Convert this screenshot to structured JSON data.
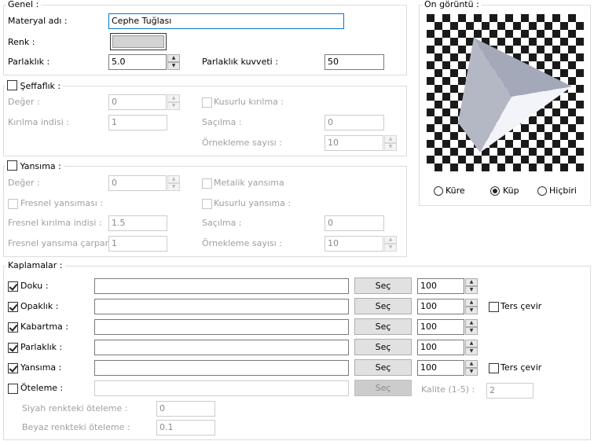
{
  "general": {
    "legend": "Genel :",
    "material_name_label": "Materyal adı :",
    "material_name_value": "Cephe Tuğlası",
    "color_label": "Renk :",
    "color_value": "#d3d3d3",
    "brightness_label": "Parlaklık :",
    "brightness_value": "5.0",
    "brightness_strength_label": "Parlaklık kuvveti :",
    "brightness_strength_value": "50"
  },
  "transparency": {
    "legend": "Şeffaflık :",
    "value_label": "Değer :",
    "value": "0",
    "refraction_index_label": "Kırılma indisi :",
    "refraction_index": "1",
    "imperfect_refraction_label": "Kusurlu kırılma :",
    "scatter_label": "Saçılma :",
    "scatter_value": "0",
    "sample_count_label": "Örnekleme sayısı :",
    "sample_count_value": "10"
  },
  "reflection": {
    "legend": "Yansıma :",
    "value_label": "Değer :",
    "value": "0",
    "metallic_label": "Metalik yansıma",
    "fresnel_label": "Fresnel yansıması :",
    "imperfect_label": "Kusurlu yansıma :",
    "fresnel_index_label": "Fresnel kırılma indisi :",
    "fresnel_index_value": "1.5",
    "scatter_label": "Saçılma :",
    "scatter_value": "0",
    "fresnel_multiplier_label": "Fresnel yansıma çarpanı :",
    "fresnel_multiplier_value": "1",
    "sample_count_label": "Örnekleme sayısı :",
    "sample_count_value": "10"
  },
  "preview": {
    "legend": "Ön görüntü :",
    "options": [
      "Küre",
      "Küp",
      "Hiçbiri"
    ],
    "selected": "Küp"
  },
  "maps": {
    "legend": "Kaplamalar :",
    "rows": [
      {
        "label": "Doku :",
        "path": "",
        "button": "Seç",
        "amount": "100",
        "invert_label": ""
      },
      {
        "label": "Opaklık :",
        "path": "",
        "button": "Seç",
        "amount": "100",
        "invert_label": "Ters çevir"
      },
      {
        "label": "Kabartma :",
        "path": "",
        "button": "Seç",
        "amount": "100",
        "invert_label": ""
      },
      {
        "label": "Parlaklık :",
        "path": "",
        "button": "Seç",
        "amount": "100",
        "invert_label": ""
      },
      {
        "label": "Yansıma :",
        "path": "",
        "button": "Seç",
        "amount": "100",
        "invert_label": "Ters çevir"
      }
    ],
    "displacement": {
      "label": "Öteleme :",
      "button": "Seç",
      "quality_label": "Kalite (1-5) :",
      "quality_value": "2",
      "black_label": "Siyah renkteki öteleme :",
      "black_value": "0",
      "white_label": "Beyaz renkteki öteleme :",
      "white_value": "0.1"
    }
  }
}
